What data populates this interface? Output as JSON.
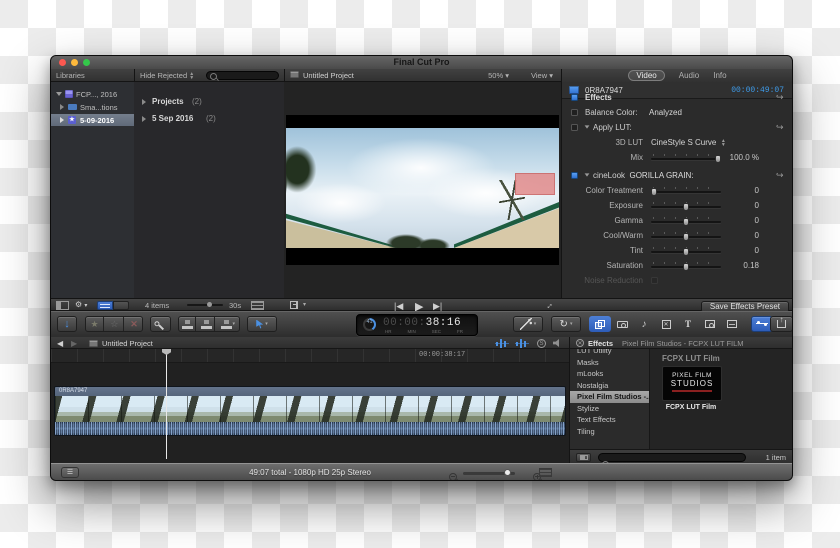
{
  "window": {
    "title": "Final Cut Pro"
  },
  "libraries": {
    "header": "Libraries",
    "filter_label": "Hide Rejected",
    "items": [
      {
        "label": "FCP..., 2016"
      },
      {
        "label": "Sma...tions"
      },
      {
        "label": "5-09-2016"
      }
    ]
  },
  "event_browser": {
    "groups": [
      {
        "label": "Projects",
        "count": "(2)"
      },
      {
        "label": "5 Sep 2016",
        "count": "(2)"
      }
    ],
    "items_count": "4 items",
    "duration": "30s"
  },
  "viewer": {
    "title": "Untitled Project",
    "zoom_level": "50%",
    "view_label": "View"
  },
  "inspector": {
    "tabs": [
      {
        "label": "Video"
      },
      {
        "label": "Audio"
      },
      {
        "label": "Info"
      }
    ],
    "clip_name": "0R8A7947",
    "clip_timecode": "00:00:49:07",
    "effects_header": "Effects",
    "balance_label": "Balance Color:",
    "balance_value": "Analyzed",
    "apply_lut_label": "Apply LUT:",
    "lut_label": "3D LUT",
    "lut_value": "CineStyle S Curve",
    "mix_label": "Mix",
    "mix_value": "100.0 %",
    "cinelook_name": "cineLook",
    "cinelook_effect": "GORILLA GRAIN:",
    "params": [
      {
        "label": "Color Treatment",
        "value": "0"
      },
      {
        "label": "Exposure",
        "value": "0"
      },
      {
        "label": "Gamma",
        "value": "0"
      },
      {
        "label": "Cool/Warm",
        "value": "0"
      },
      {
        "label": "Tint",
        "value": "0"
      },
      {
        "label": "Saturation",
        "value": "0.18"
      }
    ],
    "partial_row_label": "Noise Reduction",
    "save_preset_label": "Save Effects Preset"
  },
  "toolbar": {
    "dashboard": {
      "task_percent": "41",
      "tc_dim": "00:00:",
      "tc_bright": "38:16",
      "units": [
        "HR",
        "MIN",
        "SEC",
        "FR"
      ]
    }
  },
  "timeline": {
    "project_title": "Untitled Project",
    "ruler_timecode": "00:00:38:17",
    "clip_name": "0R8A7947",
    "status_text": "49:07 total - 1080p HD 25p Stereo"
  },
  "effects_panel": {
    "header_title": "Effects",
    "header_breadcrumb": "Pixel Film Studios - FCPX LUT FILM",
    "categories": [
      {
        "label": "LUT Utility"
      },
      {
        "label": "Masks"
      },
      {
        "label": "mLooks"
      },
      {
        "label": "Nostalgia"
      },
      {
        "label": "Pixel Film Studios -..."
      },
      {
        "label": "Stylize"
      },
      {
        "label": "Text Effects"
      },
      {
        "label": "Tiling"
      }
    ],
    "group_title": "FCPX LUT Film",
    "thumb_line1": "PIXEL FILM",
    "thumb_line2": "STUDIOS",
    "effect_label": "FCPX LUT Film",
    "item_count": "1 item"
  }
}
